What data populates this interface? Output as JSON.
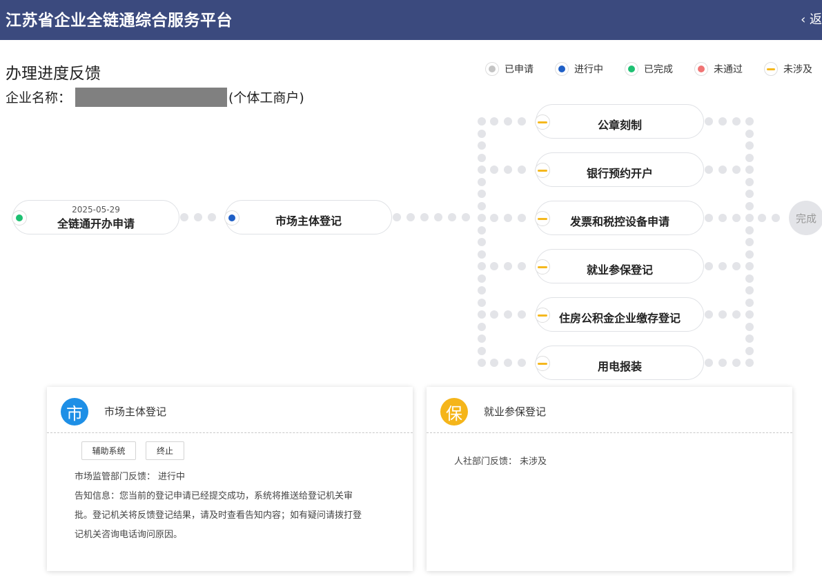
{
  "header": {
    "title": "江苏省企业全链通综合服务平台",
    "back_label": "‹ 返"
  },
  "page": {
    "title": "办理进度反馈",
    "company_label": "企业名称：",
    "company_suffix": "(个体工商户)"
  },
  "legend": [
    {
      "label": "已申请",
      "color": "#c4c4c4",
      "shape": "dot"
    },
    {
      "label": "进行中",
      "color": "#1f5fc6",
      "shape": "dot"
    },
    {
      "label": "已完成",
      "color": "#1ec072",
      "shape": "dot"
    },
    {
      "label": "未通过",
      "color": "#f07474",
      "shape": "dot"
    },
    {
      "label": "未涉及",
      "color": "#f5b81e",
      "shape": "dash"
    }
  ],
  "flow": {
    "apply": {
      "label": "全链通开办申请",
      "date": "2025-05-29",
      "status": "已完成"
    },
    "register": {
      "label": "市场主体登记",
      "status": "进行中"
    },
    "branches": [
      {
        "label": "公章刻制",
        "status": "未涉及"
      },
      {
        "label": "银行预约开户",
        "status": "未涉及"
      },
      {
        "label": "发票和税控设备申请",
        "status": "未涉及"
      },
      {
        "label": "就业参保登记",
        "status": "未涉及"
      },
      {
        "label": "住房公积金企业缴存登记",
        "status": "未涉及"
      },
      {
        "label": "用电报装",
        "status": "未涉及"
      }
    ],
    "finish_label": "完成"
  },
  "cards": [
    {
      "badge": "市",
      "badge_color": "#1e8fe6",
      "title": "市场主体登记",
      "buttons": [
        "辅助系统",
        "终止"
      ],
      "feedback_label": "市场监管部门反馈：",
      "feedback_value": "进行中",
      "notice_lines": [
        "告知信息：您当前的登记申请已经提交成功，系统将推送给登记机关审",
        "批。登记机关将反馈登记结果，请及时查看告知内容；如有疑问请拨打登",
        "记机关咨询电话询问原因。"
      ]
    },
    {
      "badge": "保",
      "badge_color": "#f5b51a",
      "title": "就业参保登记",
      "feedback_label": "人社部门反馈：",
      "feedback_value": "未涉及"
    }
  ]
}
